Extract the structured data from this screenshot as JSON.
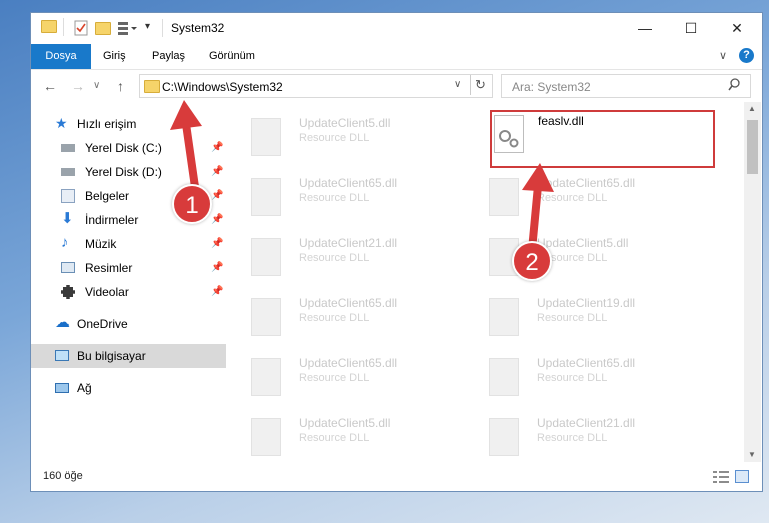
{
  "window": {
    "title": "System32"
  },
  "ribbon": {
    "tabs": [
      "Dosya",
      "Giriş",
      "Paylaş",
      "Görünüm"
    ]
  },
  "address": {
    "path": "C:\\Windows\\System32"
  },
  "search": {
    "placeholder": "Ara: System32"
  },
  "nav": {
    "quick_access": "Hızlı erişim",
    "items": [
      "Yerel Disk (C:)",
      "Yerel Disk (D:)",
      "Belgeler",
      "İndirmeler",
      "Müzik",
      "Resimler",
      "Videolar"
    ],
    "onedrive": "OneDrive",
    "this_pc": "Bu bilgisayar",
    "network": "Ağ"
  },
  "files": {
    "left": [
      {
        "name": "UpdateClient5.dll",
        "type": "Resource DLL"
      },
      {
        "name": "UpdateClient65.dll",
        "type": "Resource DLL"
      },
      {
        "name": "UpdateClient21.dll",
        "type": "Resource DLL"
      },
      {
        "name": "UpdateClient65.dll",
        "type": "Resource DLL"
      },
      {
        "name": "UpdateClient65.dll",
        "type": "Resource DLL"
      },
      {
        "name": "UpdateClient5.dll",
        "type": "Resource DLL"
      }
    ],
    "right": [
      {
        "name": "feaslv.dll",
        "type": ""
      },
      {
        "name": "UpdateClient65.dll",
        "type": "Resource DLL"
      },
      {
        "name": "UpdateClient5.dll",
        "type": "Resource DLL"
      },
      {
        "name": "UpdateClient19.dll",
        "type": "Resource DLL"
      },
      {
        "name": "UpdateClient65.dll",
        "type": "Resource DLL"
      },
      {
        "name": "UpdateClient21.dll",
        "type": "Resource DLL"
      }
    ]
  },
  "status": {
    "count": "160 öğe"
  },
  "callouts": [
    "1",
    "2"
  ],
  "colors": {
    "accent": "#1979ca",
    "highlight": "#cf3b3b",
    "arrow": "#d83b3b"
  }
}
